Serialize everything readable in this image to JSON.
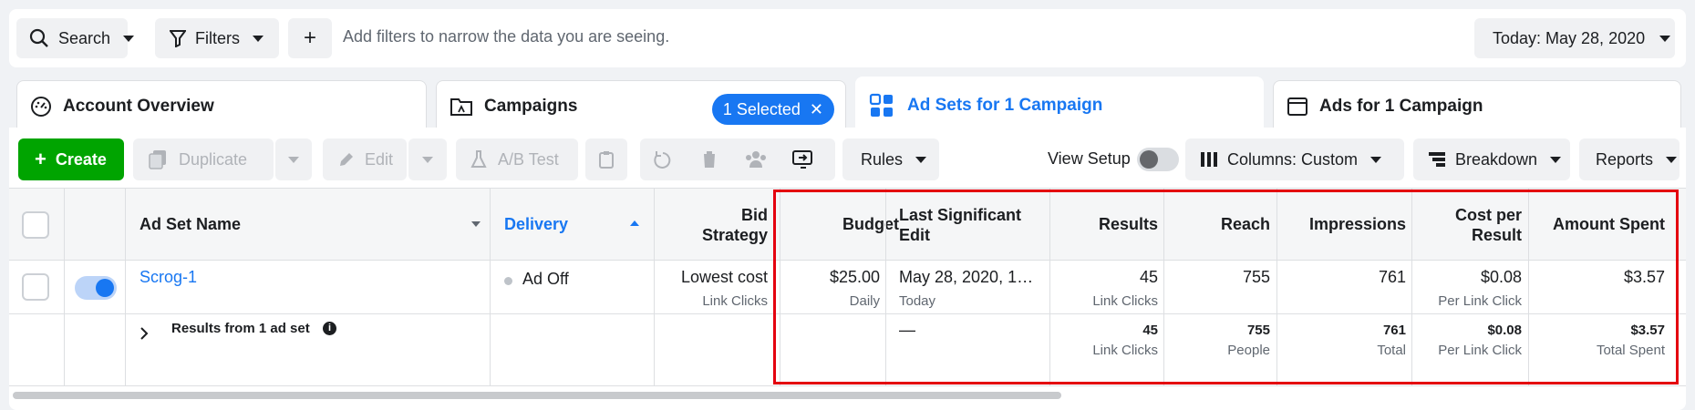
{
  "filterbar": {
    "search_label": "Search",
    "filters_label": "Filters",
    "add_label": "+",
    "placeholder": "Add filters to narrow the data you are seeing.",
    "date_label": "Today: May 28, 2020"
  },
  "tabs": {
    "account": "Account Overview",
    "campaigns": "Campaigns",
    "selected_badge": "1 Selected",
    "adsets": "Ad Sets for 1 Campaign",
    "ads": "Ads for 1 Campaign"
  },
  "toolbar": {
    "create": "Create",
    "duplicate": "Duplicate",
    "edit": "Edit",
    "ab_test": "A/B Test",
    "rules": "Rules",
    "view_setup": "View Setup",
    "columns": "Columns: Custom",
    "breakdown": "Breakdown",
    "reports": "Reports"
  },
  "table": {
    "headers": {
      "name": "Ad Set Name",
      "delivery": "Delivery",
      "bid_1": "Bid",
      "bid_2": "Strategy",
      "budget": "Budget",
      "last_edit_1": "Last Significant",
      "last_edit_2": "Edit",
      "results": "Results",
      "reach": "Reach",
      "impressions": "Impressions",
      "cpr_1": "Cost per",
      "cpr_2": "Result",
      "amount": "Amount Spent"
    },
    "row": {
      "name": "Scrog-1",
      "delivery": "Ad Off",
      "bid": "Lowest cost",
      "bid_sub": "Link Clicks",
      "budget": "$25.00",
      "budget_sub": "Daily",
      "last_edit": "May 28, 2020, 1…",
      "last_edit_sub": "Today",
      "results": "45",
      "results_sub": "Link Clicks",
      "reach": "755",
      "impressions": "761",
      "cpr": "$0.08",
      "cpr_sub": "Per Link Click",
      "amount": "$3.57"
    },
    "summary": {
      "label": "Results from 1 ad set",
      "last_edit": "—",
      "results": "45",
      "results_sub": "Link Clicks",
      "reach": "755",
      "reach_sub": "People",
      "impressions": "761",
      "impressions_sub": "Total",
      "cpr": "$0.08",
      "cpr_sub": "Per Link Click",
      "amount": "$3.57",
      "amount_sub": "Total Spent"
    }
  },
  "colors": {
    "accent": "#1877f2",
    "create": "#00a400",
    "highlight": "#e4000f"
  }
}
